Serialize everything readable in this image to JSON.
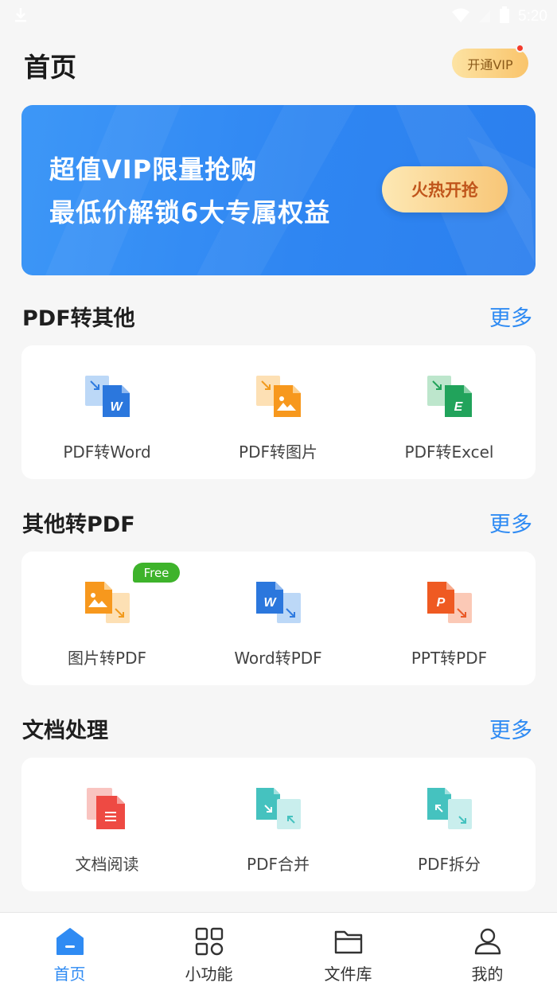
{
  "status_bar": {
    "time": "5:20",
    "icons": [
      "download-icon",
      "wifi-icon",
      "signal-icon",
      "battery-icon"
    ]
  },
  "header": {
    "title": "首页",
    "vip_button": "开通VIP"
  },
  "banner": {
    "line1": "超值VIP限量抢购",
    "line2": "最低价解锁6大专属权益",
    "cta": "火热开抢"
  },
  "sections": [
    {
      "title": "PDF转其他",
      "more": "更多",
      "tools": [
        {
          "label": "PDF转Word",
          "icon": "pdf-to-word-icon"
        },
        {
          "label": "PDF转图片",
          "icon": "pdf-to-image-icon"
        },
        {
          "label": "PDF转Excel",
          "icon": "pdf-to-excel-icon"
        }
      ]
    },
    {
      "title": "其他转PDF",
      "more": "更多",
      "tools": [
        {
          "label": "图片转PDF",
          "icon": "image-to-pdf-icon",
          "badge": "Free"
        },
        {
          "label": "Word转PDF",
          "icon": "word-to-pdf-icon"
        },
        {
          "label": "PPT转PDF",
          "icon": "ppt-to-pdf-icon"
        }
      ]
    },
    {
      "title": "文档处理",
      "more": "更多",
      "tools": [
        {
          "label": "文档阅读",
          "icon": "document-read-icon"
        },
        {
          "label": "PDF合并",
          "icon": "pdf-merge-icon"
        },
        {
          "label": "PDF拆分",
          "icon": "pdf-split-icon"
        }
      ]
    }
  ],
  "bottom_nav": [
    {
      "label": "首页",
      "icon": "home-icon",
      "active": true
    },
    {
      "label": "小功能",
      "icon": "grid-icon",
      "active": false
    },
    {
      "label": "文件库",
      "icon": "folder-icon",
      "active": false
    },
    {
      "label": "我的",
      "icon": "user-icon",
      "active": false
    }
  ],
  "colors": {
    "accent": "#2f8bf3",
    "banner": "#3390f5",
    "free_badge": "#3eb32b",
    "vip_gold": "#f9c46b"
  }
}
